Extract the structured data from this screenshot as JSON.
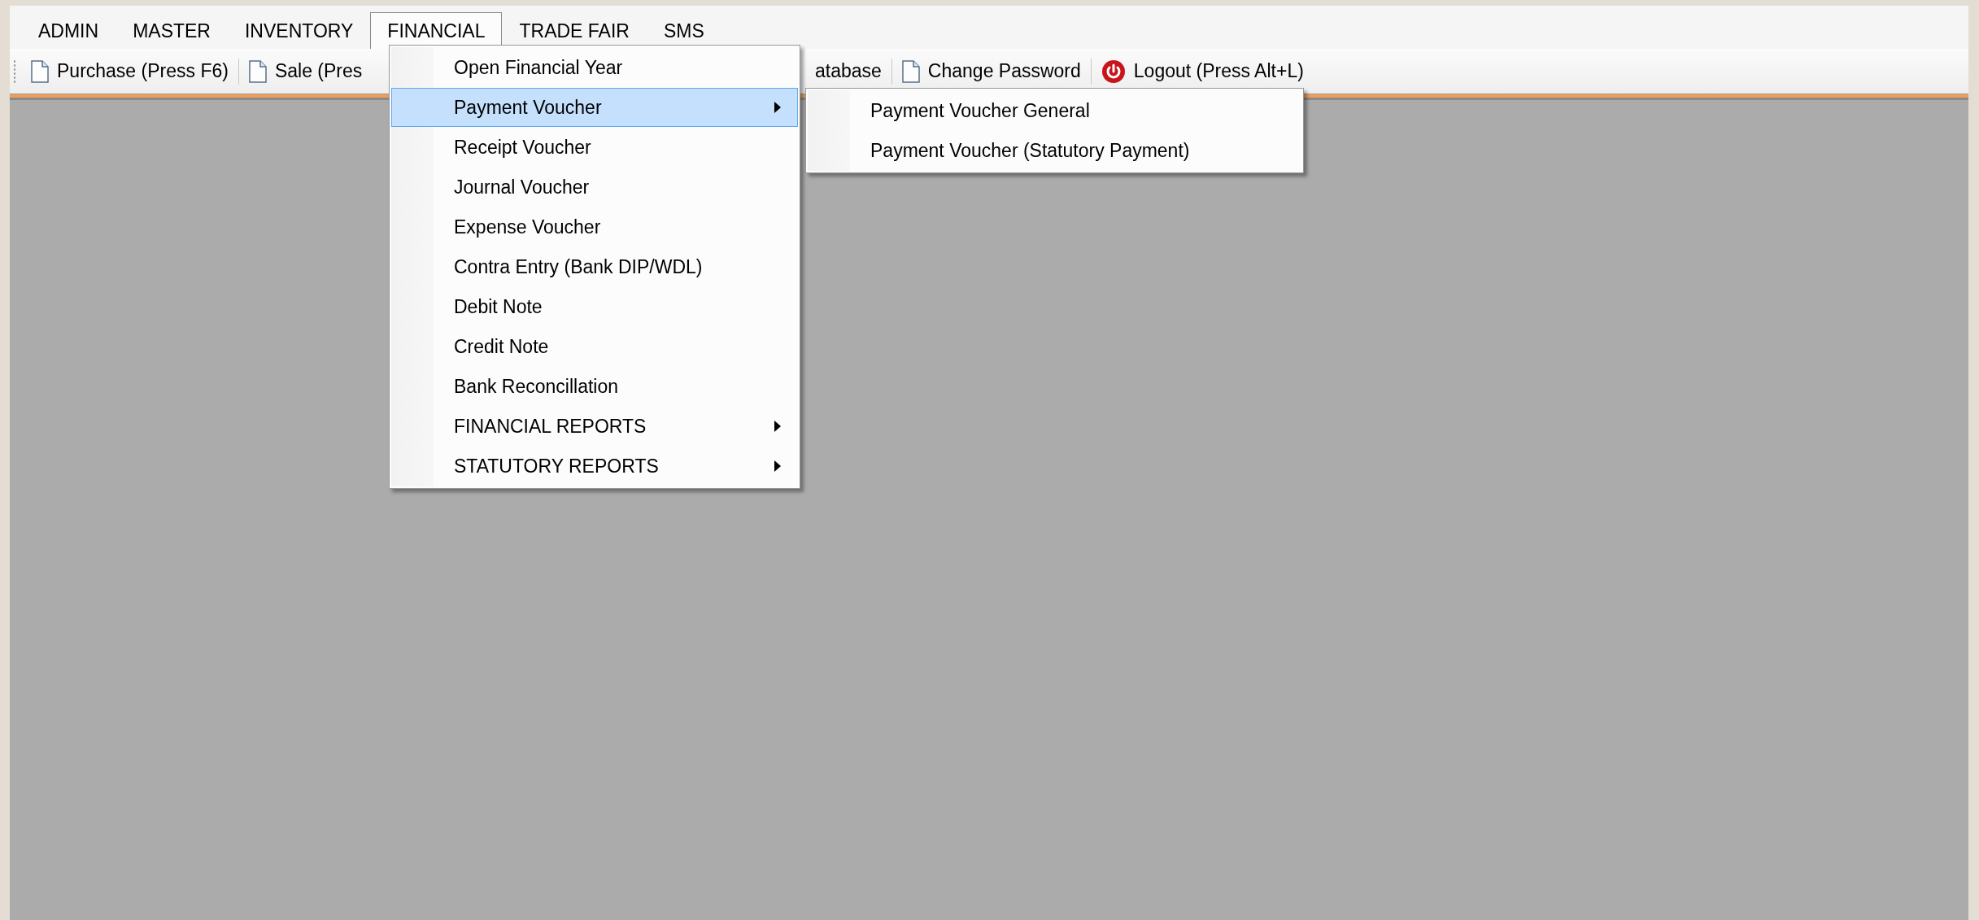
{
  "menu_bar": [
    {
      "label": "ADMIN",
      "selected": false
    },
    {
      "label": "MASTER",
      "selected": false
    },
    {
      "label": "INVENTORY",
      "selected": false
    },
    {
      "label": "FINANCIAL",
      "selected": true
    },
    {
      "label": "TRADE FAIR",
      "selected": false
    },
    {
      "label": "SMS",
      "selected": false
    }
  ],
  "toolbar_left": [
    {
      "label": "Purchase (Press F6)",
      "kind": "document"
    },
    {
      "label": "Sale (Pres",
      "kind": "document"
    }
  ],
  "toolbar_right": [
    {
      "label": "atabase",
      "kind": "plain"
    },
    {
      "label": "Change Password",
      "kind": "document"
    },
    {
      "label": "Logout (Press Alt+L)",
      "kind": "power"
    }
  ],
  "dropdown": [
    {
      "label": "Open Financial Year",
      "selected": false,
      "has_submenu": false
    },
    {
      "label": "Payment Voucher",
      "selected": true,
      "has_submenu": true
    },
    {
      "label": "Receipt Voucher",
      "selected": false,
      "has_submenu": false
    },
    {
      "label": "Journal Voucher",
      "selected": false,
      "has_submenu": false
    },
    {
      "label": "Expense Voucher",
      "selected": false,
      "has_submenu": false
    },
    {
      "label": "Contra Entry (Bank DIP/WDL)",
      "selected": false,
      "has_submenu": false
    },
    {
      "label": "Debit Note",
      "selected": false,
      "has_submenu": false
    },
    {
      "label": "Credit Note",
      "selected": false,
      "has_submenu": false
    },
    {
      "label": "Bank Reconcillation",
      "selected": false,
      "has_submenu": false
    },
    {
      "label": "FINANCIAL REPORTS",
      "selected": false,
      "has_submenu": true
    },
    {
      "label": "STATUTORY REPORTS",
      "selected": false,
      "has_submenu": true
    }
  ],
  "submenu": [
    {
      "label": "Payment Voucher General",
      "selected": false,
      "has_submenu": false
    },
    {
      "label": "Payment Voucher (Statutory Payment)",
      "selected": false,
      "has_submenu": false
    }
  ]
}
